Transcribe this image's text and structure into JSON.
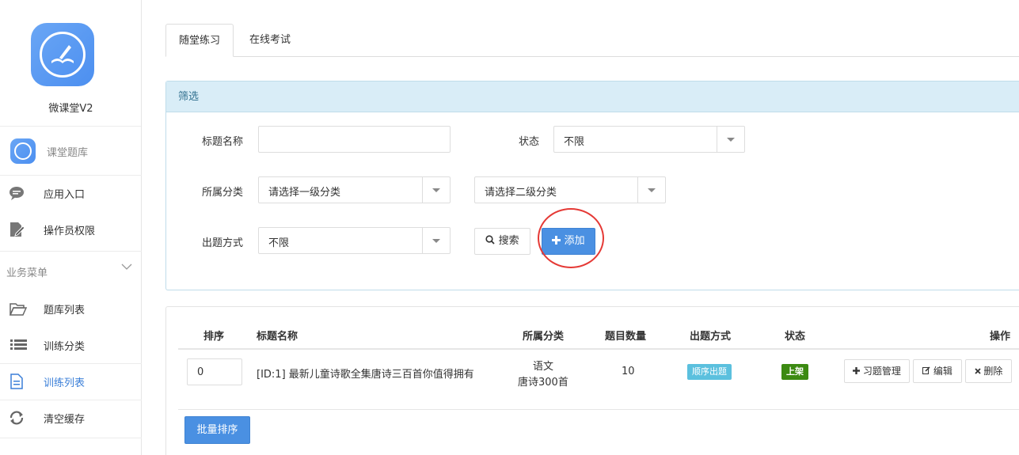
{
  "sidebar": {
    "app_name": "微课堂V2",
    "module_label": "课堂题库",
    "items_top": [
      {
        "label": "应用入口",
        "icon": "chat-bubble-icon"
      },
      {
        "label": "操作员权限",
        "icon": "edit-document-icon"
      }
    ],
    "section_label": "业务菜单",
    "items_business": [
      {
        "label": "题库列表",
        "icon": "folder-open-icon"
      },
      {
        "label": "训练分类",
        "icon": "list-icon"
      },
      {
        "label": "训练列表",
        "icon": "document-icon",
        "active": true
      },
      {
        "label": "清空缓存",
        "icon": "refresh-icon"
      }
    ]
  },
  "tabs": [
    {
      "label": "随堂练习",
      "active": true
    },
    {
      "label": "在线考试",
      "active": false
    }
  ],
  "filter": {
    "panel_title": "筛选",
    "title_label": "标题名称",
    "title_value": "",
    "status_label": "状态",
    "status_value": "不限",
    "category_label": "所属分类",
    "category1_value": "请选择一级分类",
    "category2_value": "请选择二级分类",
    "mode_label": "出题方式",
    "mode_value": "不限",
    "search_label": "搜索",
    "add_label": "添加"
  },
  "table": {
    "headers": {
      "sort": "排序",
      "title": "标题名称",
      "category": "所属分类",
      "count": "题目数量",
      "mode": "出题方式",
      "status": "状态",
      "ops": "操作"
    },
    "rows": [
      {
        "sort": "0",
        "title": "[ID:1] 最新儿童诗歌全集唐诗三百首你值得拥有",
        "category_1": "语文",
        "category_2": "唐诗300首",
        "count": "10",
        "mode": "顺序出题",
        "status": "上架",
        "ops": {
          "manage": "习题管理",
          "edit": "编辑",
          "delete": "删除"
        }
      }
    ],
    "batch_sort_label": "批量排序"
  },
  "colors": {
    "primary": "#4a90e2",
    "panel_header_bg": "#d9edf7",
    "badge_info": "#5bc0de",
    "badge_success": "#3c8a12",
    "highlight_circle": "#e53935"
  }
}
